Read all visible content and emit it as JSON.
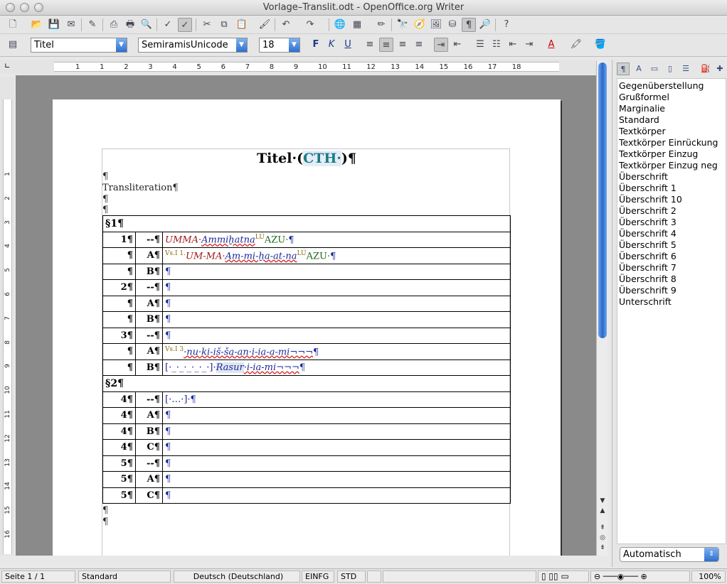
{
  "window": {
    "title": "Vorlage–Translit.odt - OpenOffice.org Writer"
  },
  "format_bar": {
    "paragraph_style": "Titel",
    "font_name": "SemiramisUnicode",
    "font_size": "18",
    "bold_label": "F",
    "italic_label": "K",
    "underline_label": "U"
  },
  "ruler": {
    "h_ticks": [
      "1",
      "1",
      "2",
      "3",
      "4",
      "5",
      "6",
      "7",
      "8",
      "9",
      "10",
      "11",
      "12",
      "13",
      "14",
      "15",
      "16",
      "17",
      "18"
    ],
    "v_ticks": [
      "1",
      "2",
      "3",
      "4",
      "5",
      "6",
      "7",
      "8",
      "9",
      "10",
      "11",
      "12",
      "13",
      "14",
      "15",
      "16"
    ]
  },
  "document": {
    "title_main": "Titel·(",
    "title_cth": "CTH·",
    "title_end": ")¶",
    "pilcrow": "¶",
    "transliteration_label": "Transliteration¶",
    "sections": [
      {
        "header": "§1¶",
        "rows": [
          {
            "num": "1¶",
            "ver": "--¶",
            "sumer": "UMMA·",
            "akk": "Ammiḫatna",
            "det": "LÚ",
            "azu": "AZU·",
            "tail": "¶"
          },
          {
            "num": "¶",
            "ver": "A¶",
            "pre_det": "Vs.I 1.",
            "sumer": "UM-MA·",
            "akk": "Am-mi-ḫa-at-na",
            "det": "LÚ",
            "azu": "AZU·",
            "tail": "¶"
          },
          {
            "num": "¶",
            "ver": "B¶",
            "tail": "¶"
          },
          {
            "num": "2¶",
            "ver": "--¶",
            "tail": "¶"
          },
          {
            "num": "¶",
            "ver": "A¶",
            "tail": "¶"
          },
          {
            "num": "¶",
            "ver": "B¶",
            "tail": "¶"
          },
          {
            "num": "3¶",
            "ver": "--¶",
            "tail": "¶"
          },
          {
            "num": "¶",
            "ver": "A¶",
            "pre_det": "Vs.I 3",
            "akk": "·nu·ki-iš-ša-an·i-ia-a-mi¬¬¬",
            "tail": "¶"
          },
          {
            "num": "¶",
            "ver": "B¶",
            "gap": "[·_·_·_·_·_·]·",
            "rasur": "Rasur",
            "akk": "·i-ia-mi¬¬¬",
            "tail": "¶"
          }
        ]
      },
      {
        "header": "§2¶",
        "rows": [
          {
            "num": "4¶",
            "ver": "--¶",
            "gap": "[·…·]·",
            "tail": "¶"
          },
          {
            "num": "4¶",
            "ver": "A¶",
            "tail": "¶"
          },
          {
            "num": "4¶",
            "ver": "B¶",
            "tail": "¶"
          },
          {
            "num": "4¶",
            "ver": "C¶",
            "tail": "¶"
          },
          {
            "num": "5¶",
            "ver": "--¶",
            "tail": "¶"
          },
          {
            "num": "5¶",
            "ver": "A¶",
            "tail": "¶"
          },
          {
            "num": "5¶",
            "ver": "C¶",
            "tail": "¶"
          }
        ]
      }
    ]
  },
  "styles_panel": {
    "items": [
      "Gegenüberstellung",
      "Grußformel",
      "Marginalie",
      "Standard",
      "Textkörper",
      "Textkörper Einrückung",
      "Textkörper Einzug",
      "Textkörper Einzug neg",
      "Überschrift",
      "Überschrift 1",
      "Überschrift 10",
      "Überschrift 2",
      "Überschrift 3",
      "Überschrift 4",
      "Überschrift 5",
      "Überschrift 6",
      "Überschrift 7",
      "Überschrift 8",
      "Überschrift 9",
      "Unterschrift"
    ],
    "filter": "Automatisch"
  },
  "status_bar": {
    "page": "Seite 1 / 1",
    "style": "Standard",
    "language": "Deutsch (Deutschland)",
    "insert_mode": "EINFG",
    "selection_mode": "STD",
    "zoom": "100%"
  }
}
